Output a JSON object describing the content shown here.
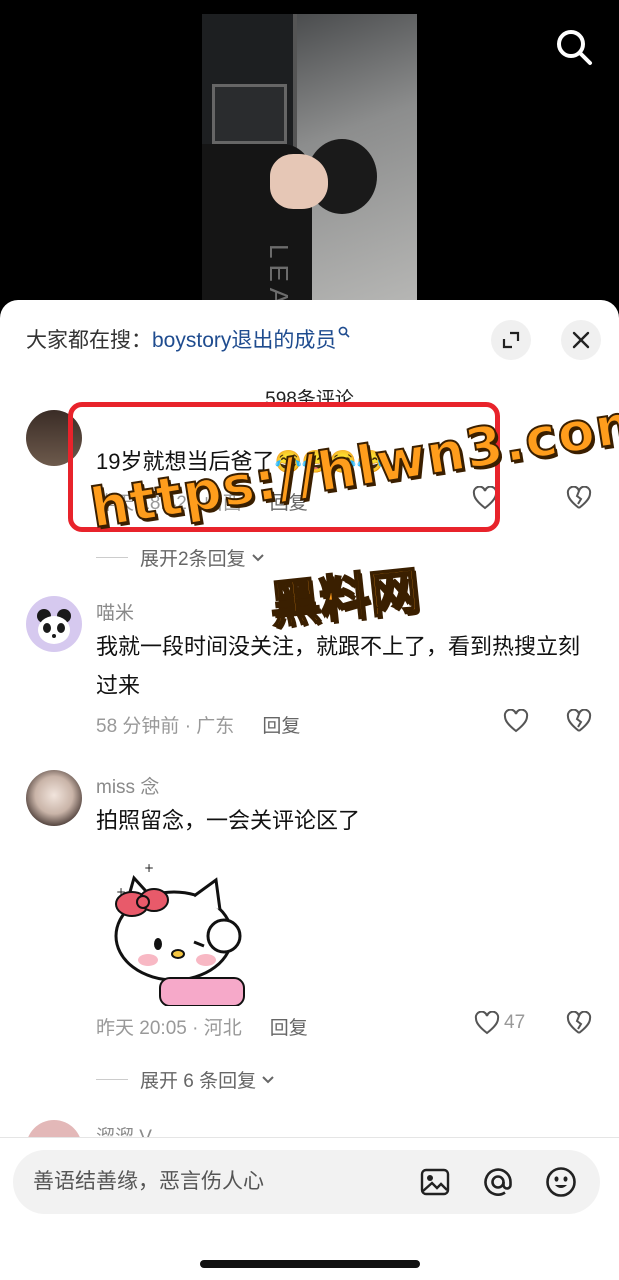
{
  "search_suggest": {
    "prefix": "大家都在搜：",
    "keyword": "boystory退出的成员"
  },
  "comment_count": "598条评论",
  "comments": [
    {
      "username": "",
      "text": "19岁就想当后爸了😂😂😂😂",
      "time_location": "昨天 18:42 · 山西",
      "reply_label": "回复",
      "expand_label": "展开2条回复"
    },
    {
      "username": "喵米",
      "text": "我就一段时间没关注，就跟不上了，看到热搜立刻过来",
      "time_location": "58 分钟前 · 广东",
      "reply_label": "回复"
    },
    {
      "username": "miss 念",
      "text": "拍照留念，一会关评论区了",
      "time_location": "昨天 20:05 · 河北",
      "reply_label": "回复",
      "likes": "47",
      "expand_label": "展开 6 条回复"
    },
    {
      "username": "溜溜 V"
    }
  ],
  "video_overlay_text": "LEA",
  "input": {
    "placeholder": "善语结善缘，恶言伤人心"
  },
  "watermark": {
    "url": "https://hlwn3.com",
    "name": "黑料网"
  },
  "colors": {
    "keyword": "#1f4c8f",
    "highlight_border": "#e8232b",
    "watermark_fill": "#ff9d1c"
  }
}
